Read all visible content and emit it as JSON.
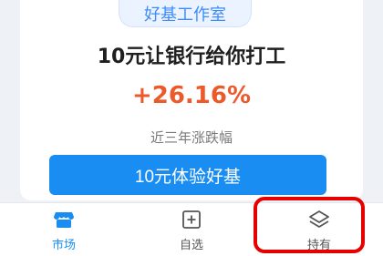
{
  "promo": {
    "badge": "好基工作室",
    "headline": "10元让银行给你打工",
    "return_value": "+26.16%",
    "return_label": "近三年涨跌幅",
    "cta_label": "10元体验好基"
  },
  "tabs": [
    {
      "label": "市场",
      "icon": "market-store-icon",
      "active": true
    },
    {
      "label": "自选",
      "icon": "add-watchlist-icon",
      "active": false
    },
    {
      "label": "持有",
      "icon": "layers-icon",
      "active": false
    }
  ],
  "colors": {
    "accent": "#1a8df3",
    "positive": "#ec5a2c",
    "highlight": "#e60000"
  }
}
